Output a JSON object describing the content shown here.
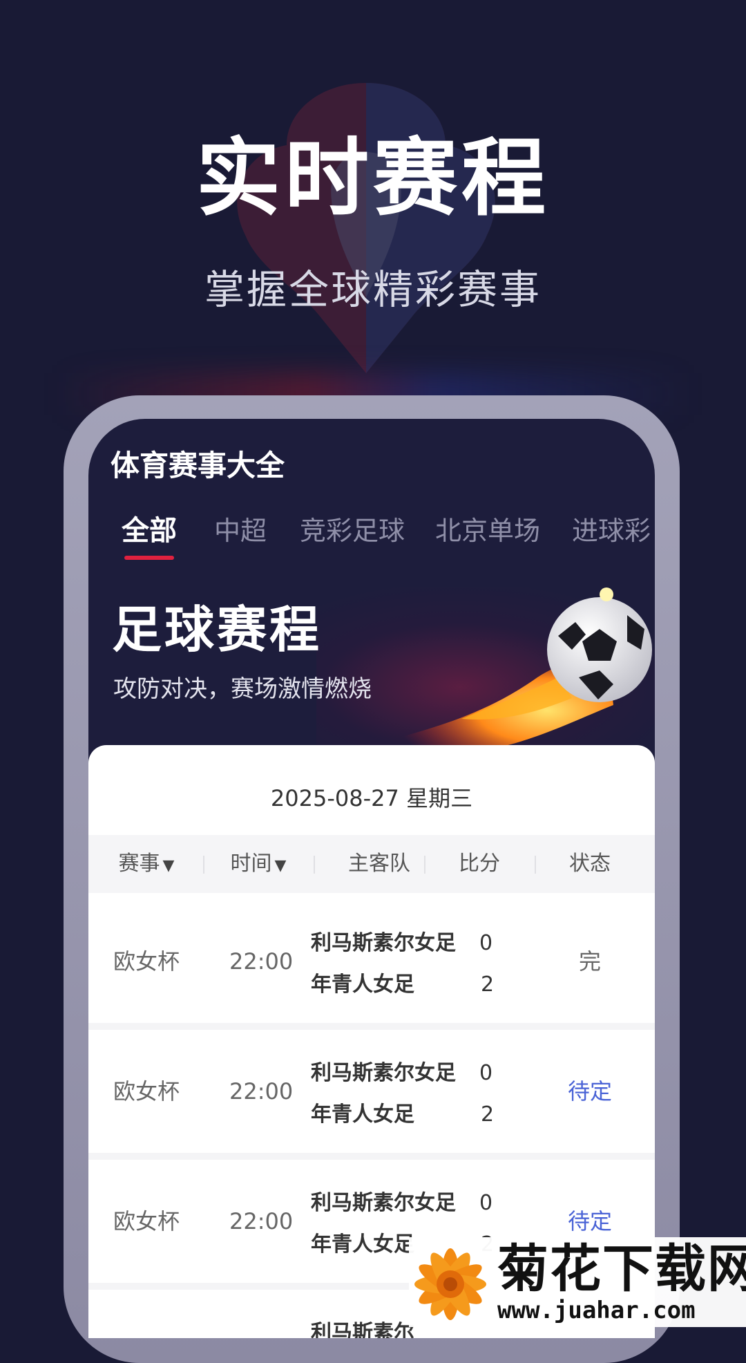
{
  "hero": {
    "title": "实时赛程",
    "subtitle": "掌握全球精彩赛事"
  },
  "app": {
    "title": "体育赛事大全",
    "tabs": [
      {
        "label": "全部",
        "active": true
      },
      {
        "label": "中超",
        "active": false
      },
      {
        "label": "竞彩足球",
        "active": false
      },
      {
        "label": "北京单场",
        "active": false
      },
      {
        "label": "进球彩",
        "active": false
      }
    ],
    "banner": {
      "title": "足球赛程",
      "subtitle": "攻防对决，赛场激情燃烧"
    },
    "schedule": {
      "date": "2025-08-27 星期三",
      "columns": [
        "赛事",
        "时间",
        "主客队",
        "比分",
        "状态"
      ],
      "sortable_icon": "caret-down-icon",
      "matches": [
        {
          "league": "欧女杯",
          "time": "22:00",
          "home": "利马斯素尔女足",
          "away": "年青人女足",
          "home_score": "0",
          "away_score": "2",
          "status": "完",
          "status_color": "#666666"
        },
        {
          "league": "欧女杯",
          "time": "22:00",
          "home": "利马斯素尔女足",
          "away": "年青人女足",
          "home_score": "0",
          "away_score": "2",
          "status": "待定",
          "status_color": "#4a63d6"
        },
        {
          "league": "欧女杯",
          "time": "22:00",
          "home": "利马斯素尔女足",
          "away": "年青人女足",
          "home_score": "0",
          "away_score": "2",
          "status": "待定",
          "status_color": "#4a63d6"
        },
        {
          "league": "",
          "time": "",
          "home": "利马斯素尔",
          "away": "",
          "home_score": "",
          "away_score": "",
          "status": "",
          "status_color": "#4a63d6"
        }
      ]
    }
  },
  "watermark": {
    "title": "菊花下载网",
    "url": "www.juahar.com"
  },
  "colors": {
    "background": "#191a35",
    "accent_red": "#e0213f",
    "pending_blue": "#4a63d6"
  }
}
